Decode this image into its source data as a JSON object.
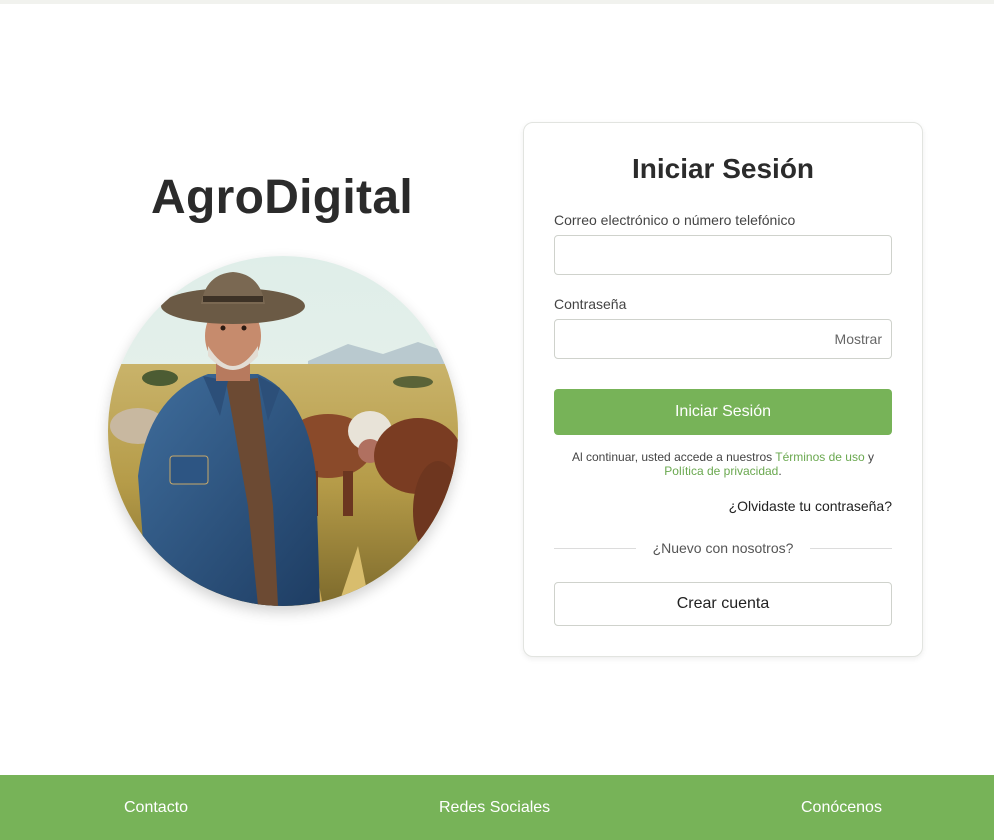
{
  "brand": {
    "name": "AgroDigital"
  },
  "hero": {
    "image_alt": "farmer-with-cattle"
  },
  "login": {
    "title": "Iniciar Sesión",
    "identifier_label": "Correo electrónico o número telefónico",
    "identifier_value": "",
    "password_label": "Contraseña",
    "password_value": "",
    "show_password": "Mostrar",
    "submit": "Iniciar Sesión",
    "legal_prefix": "Al continuar, usted accede a nuestros",
    "terms_link": "Términos de uso",
    "legal_and": "y",
    "privacy_link": "Política de privacidad",
    "legal_suffix": ".",
    "forgot": "¿Olvidaste tu contraseña?",
    "new_user": "¿Nuevo con nosotros?",
    "create_account": "Crear cuenta"
  },
  "footer": {
    "links": [
      "Contacto",
      "Redes Sociales",
      "Conócenos"
    ]
  },
  "colors": {
    "accent": "#77b358",
    "link": "#6aa84f",
    "title": "#2b2b2b"
  }
}
